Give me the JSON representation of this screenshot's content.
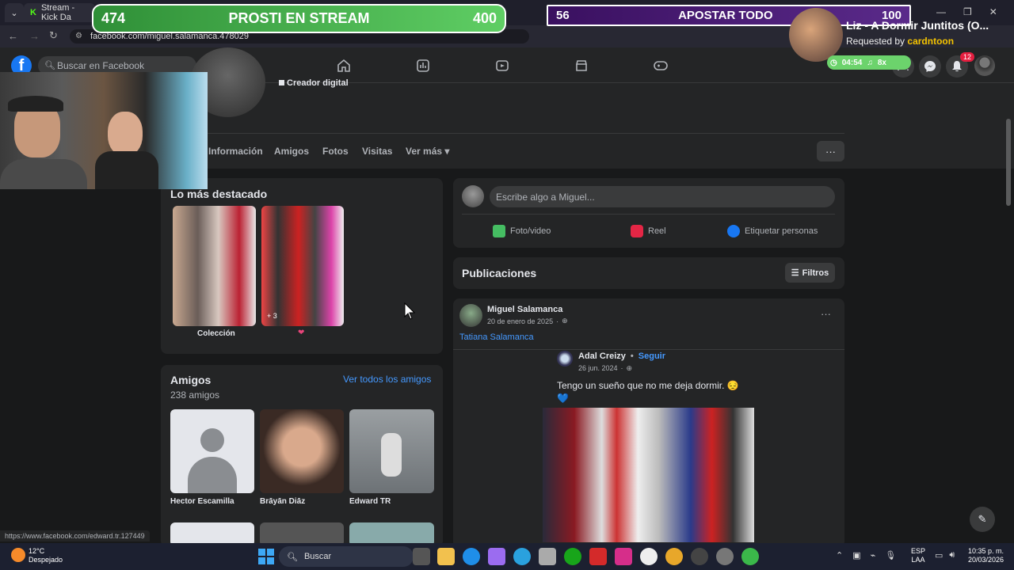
{
  "browser": {
    "tab_title": "Stream - Kick Da",
    "url": "facebook.com/miguel.salamanca.478029"
  },
  "facebook": {
    "search_placeholder": "Buscar en Facebook",
    "notification_count": "12",
    "profile_subtitle": "Creador digital",
    "tabs": [
      "Información",
      "Amigos",
      "Fotos",
      "Visitas",
      "Ver más"
    ],
    "highlights": {
      "title": "Lo más destacado",
      "items": [
        {
          "label": "Colección"
        },
        {
          "label": "❤",
          "more": "+ 3"
        }
      ]
    },
    "friends": {
      "title": "Amigos",
      "count": "238 amigos",
      "see_all": "Ver todos los amigos",
      "list": [
        {
          "name": "Hector Escamilla"
        },
        {
          "name": "Brāyān Diāz"
        },
        {
          "name": "Edward TR"
        }
      ]
    },
    "composer": {
      "placeholder": "Escribe algo a Miguel...",
      "actions": [
        "Foto/video",
        "Reel",
        "Etiquetar personas"
      ]
    },
    "posts_section": {
      "title": "Publicaciones",
      "filter": "Filtros"
    },
    "post": {
      "author": "Miguel Salamanca",
      "date": "20 de enero de 2025",
      "tagged": "Tatiana Salamanca",
      "shared": {
        "author": "Adal Creizy",
        "follow": "Seguir",
        "date": "26 jun. 2024",
        "text": "Tengo un sueño que no me deja dormir. 😔 💙"
      }
    },
    "status_url": "https://www.facebook.com/edward.tr.127449"
  },
  "overlay": {
    "bar1": {
      "left": "474",
      "label": "PROSTI EN STREAM",
      "right": "400"
    },
    "bar2": {
      "left": "56",
      "label": "APOSTAR TODO",
      "right": "100"
    },
    "song": {
      "title": "Liz - A Dormir Juntitos (O...",
      "requested_prefix": "Requested by",
      "requested_by": "cardntoon"
    },
    "timer": "04:54",
    "multiplier": "8x"
  },
  "taskbar": {
    "weather_temp": "12°C",
    "weather_desc": "Despejado",
    "search": "Buscar",
    "lang1": "ESP",
    "lang2": "LAA",
    "time": "10:35 p. m.",
    "date": "20/03/2026"
  },
  "colors": {
    "fb_blue": "#1877f2",
    "green_bar": "#3db84a",
    "purple_bar": "#4a1a7a"
  }
}
